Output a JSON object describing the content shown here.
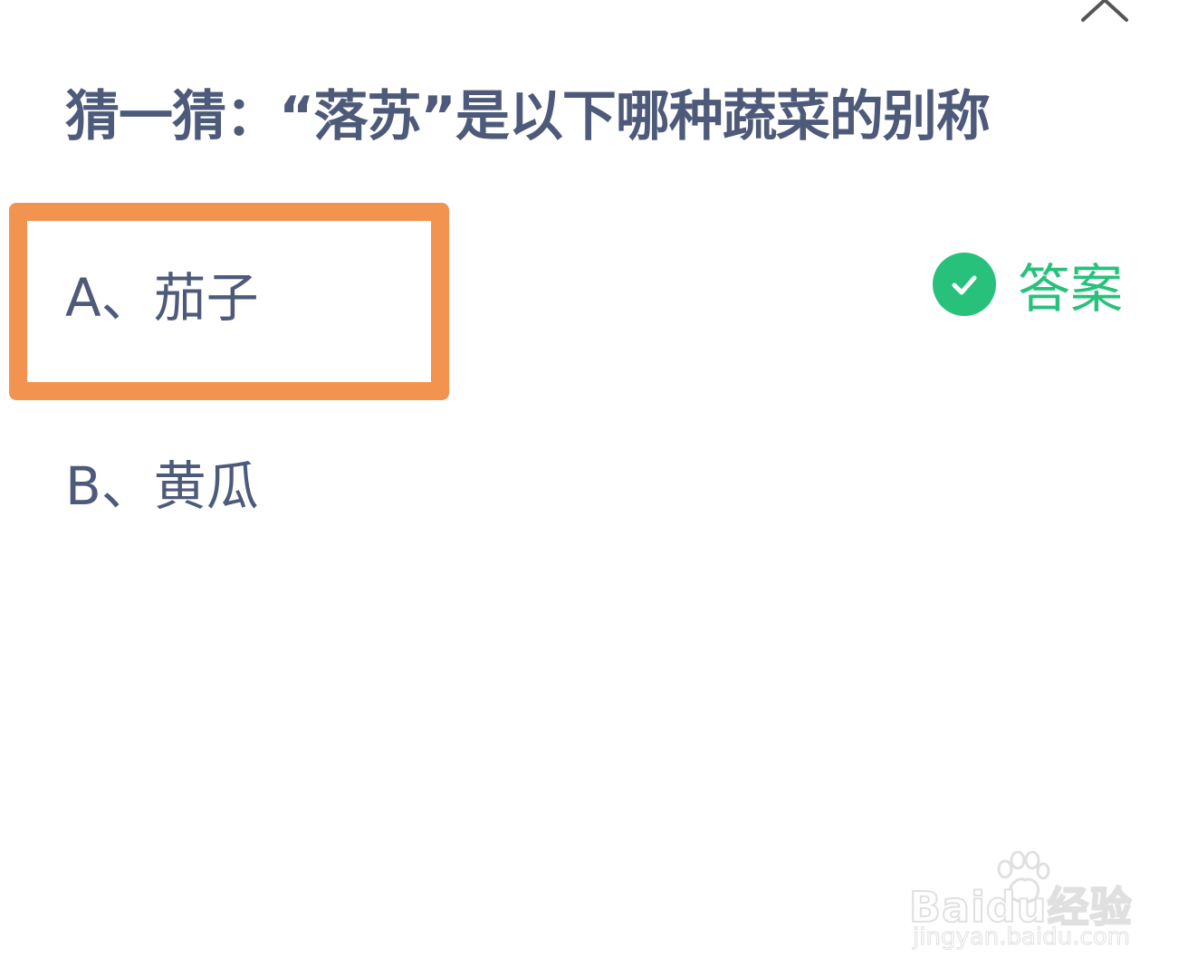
{
  "question": {
    "title": "猜一猜：“落苏”是以下哪种蔬菜的别称"
  },
  "options": [
    {
      "text": "A、茄子"
    },
    {
      "text": "B、黄瓜"
    }
  ],
  "answer": {
    "label": "答案"
  },
  "icons": {
    "collapse": "chevron-up-icon",
    "answer": "check-circle-icon",
    "watermark": "baidu-paw-icon"
  },
  "watermark": {
    "brand": "Baidu经验",
    "url": "jingyan.baidu.com"
  },
  "colors": {
    "title_text": "#4d5a7a",
    "option_text": "#4d5a7a",
    "highlight": "#f39350",
    "answer_accent": "#27c17c"
  }
}
